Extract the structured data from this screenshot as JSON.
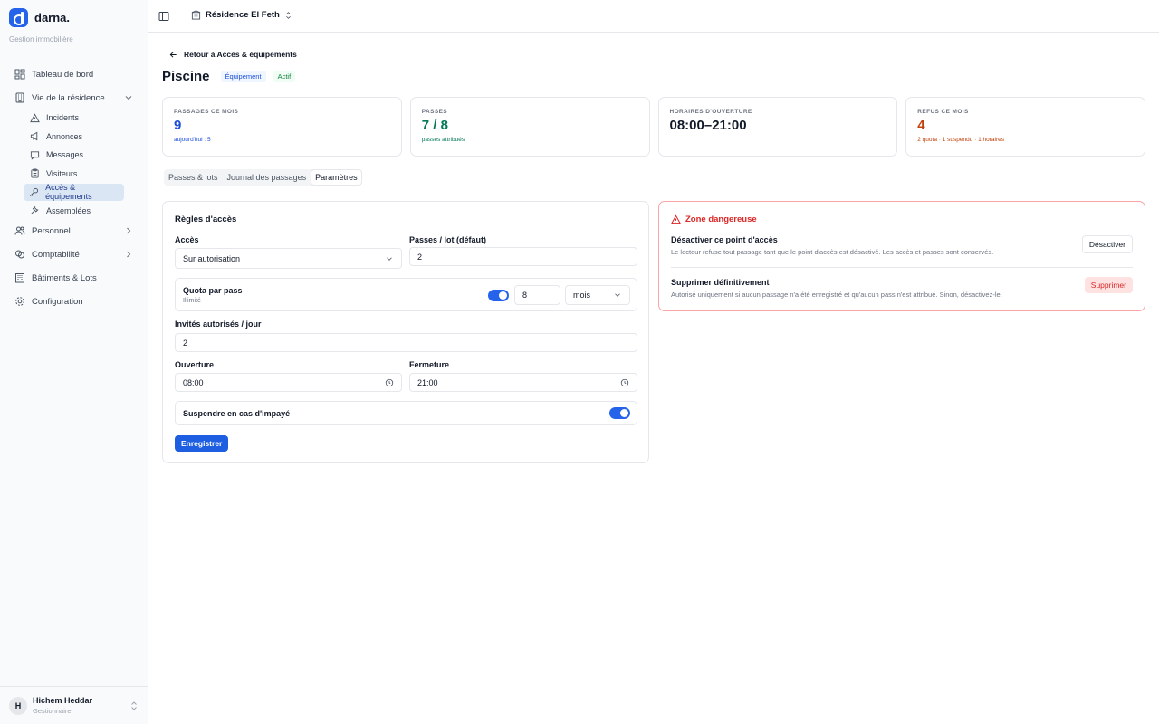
{
  "brand": {
    "name": "darna.",
    "subtitle": "Gestion immobilière"
  },
  "sidebar": {
    "items": [
      {
        "label": "Tableau de bord",
        "icon": "dashboard-icon"
      },
      {
        "label": "Vie de la résidence",
        "icon": "building-icon",
        "expanded": true,
        "children": [
          {
            "label": "Incidents",
            "icon": "warning-icon"
          },
          {
            "label": "Annonces",
            "icon": "megaphone-icon"
          },
          {
            "label": "Messages",
            "icon": "message-icon"
          },
          {
            "label": "Visiteurs",
            "icon": "clipboard-icon"
          },
          {
            "label": "Accès & équipements",
            "icon": "key-icon",
            "active": true
          },
          {
            "label": "Assemblées",
            "icon": "gavel-icon"
          }
        ]
      },
      {
        "label": "Personnel",
        "icon": "users-icon"
      },
      {
        "label": "Comptabilité",
        "icon": "coins-icon"
      },
      {
        "label": "Bâtiments & Lots",
        "icon": "buildings-icon"
      },
      {
        "label": "Configuration",
        "icon": "gear-icon"
      }
    ]
  },
  "user": {
    "initial": "H",
    "name": "Hichem Heddar",
    "role": "Gestionnaire"
  },
  "topbar": {
    "residence": "Résidence El Feth"
  },
  "page": {
    "back_label": "Retour à Accès & équipements",
    "title": "Piscine",
    "badge_type": "Équipement",
    "badge_status": "Actif"
  },
  "stats": [
    {
      "label": "PASSAGES CE MOIS",
      "value": "9",
      "sub": "aujourd'hui : 5",
      "color": "#1d4ed8"
    },
    {
      "label": "PASSES",
      "value": "7 / 8",
      "sub": "passes attribués",
      "color": "#047857"
    },
    {
      "label": "HORAIRES D'OUVERTURE",
      "value": "08:00–21:00",
      "sub": "",
      "color": "#111827"
    },
    {
      "label": "REFUS CE MOIS",
      "value": "4",
      "sub": "2 quota · 1 suspendu · 1 horaires",
      "color": "#c2410c"
    }
  ],
  "tabs": [
    {
      "label": "Passes & lots",
      "active": false
    },
    {
      "label": "Journal des passages",
      "active": false
    },
    {
      "label": "Paramètres",
      "active": true
    }
  ],
  "rules": {
    "title": "Règles d'accès",
    "access_label": "Accès",
    "access_value": "Sur autorisation",
    "passes_label": "Passes / lot (défaut)",
    "passes_value": "2",
    "quota_label": "Quota par pass",
    "quota_sub": "Illimité",
    "quota_enabled": true,
    "quota_value": "8",
    "quota_unit": "mois",
    "guests_label": "Invités autorisés / jour",
    "guests_value": "2",
    "open_label": "Ouverture",
    "open_value": "08:00",
    "close_label": "Fermeture",
    "close_value": "21:00",
    "suspend_label": "Suspendre en cas d'impayé",
    "suspend_enabled": true,
    "save_label": "Enregistrer"
  },
  "danger": {
    "title": "Zone dangereuse",
    "disable_title": "Désactiver ce point d'accès",
    "disable_desc": "Le lecteur refuse tout passage tant que le point d'accès est désactivé. Les accès et passes sont conservés.",
    "disable_button": "Désactiver",
    "delete_title": "Supprimer définitivement",
    "delete_desc": "Autorisé uniquement si aucun passage n'a été enregistré et qu'aucun pass n'est attribué. Sinon, désactivez-le.",
    "delete_button": "Supprimer"
  },
  "colors": {
    "accent": "#2563eb",
    "danger": "#dc2626",
    "danger_border": "#fca5a5"
  }
}
